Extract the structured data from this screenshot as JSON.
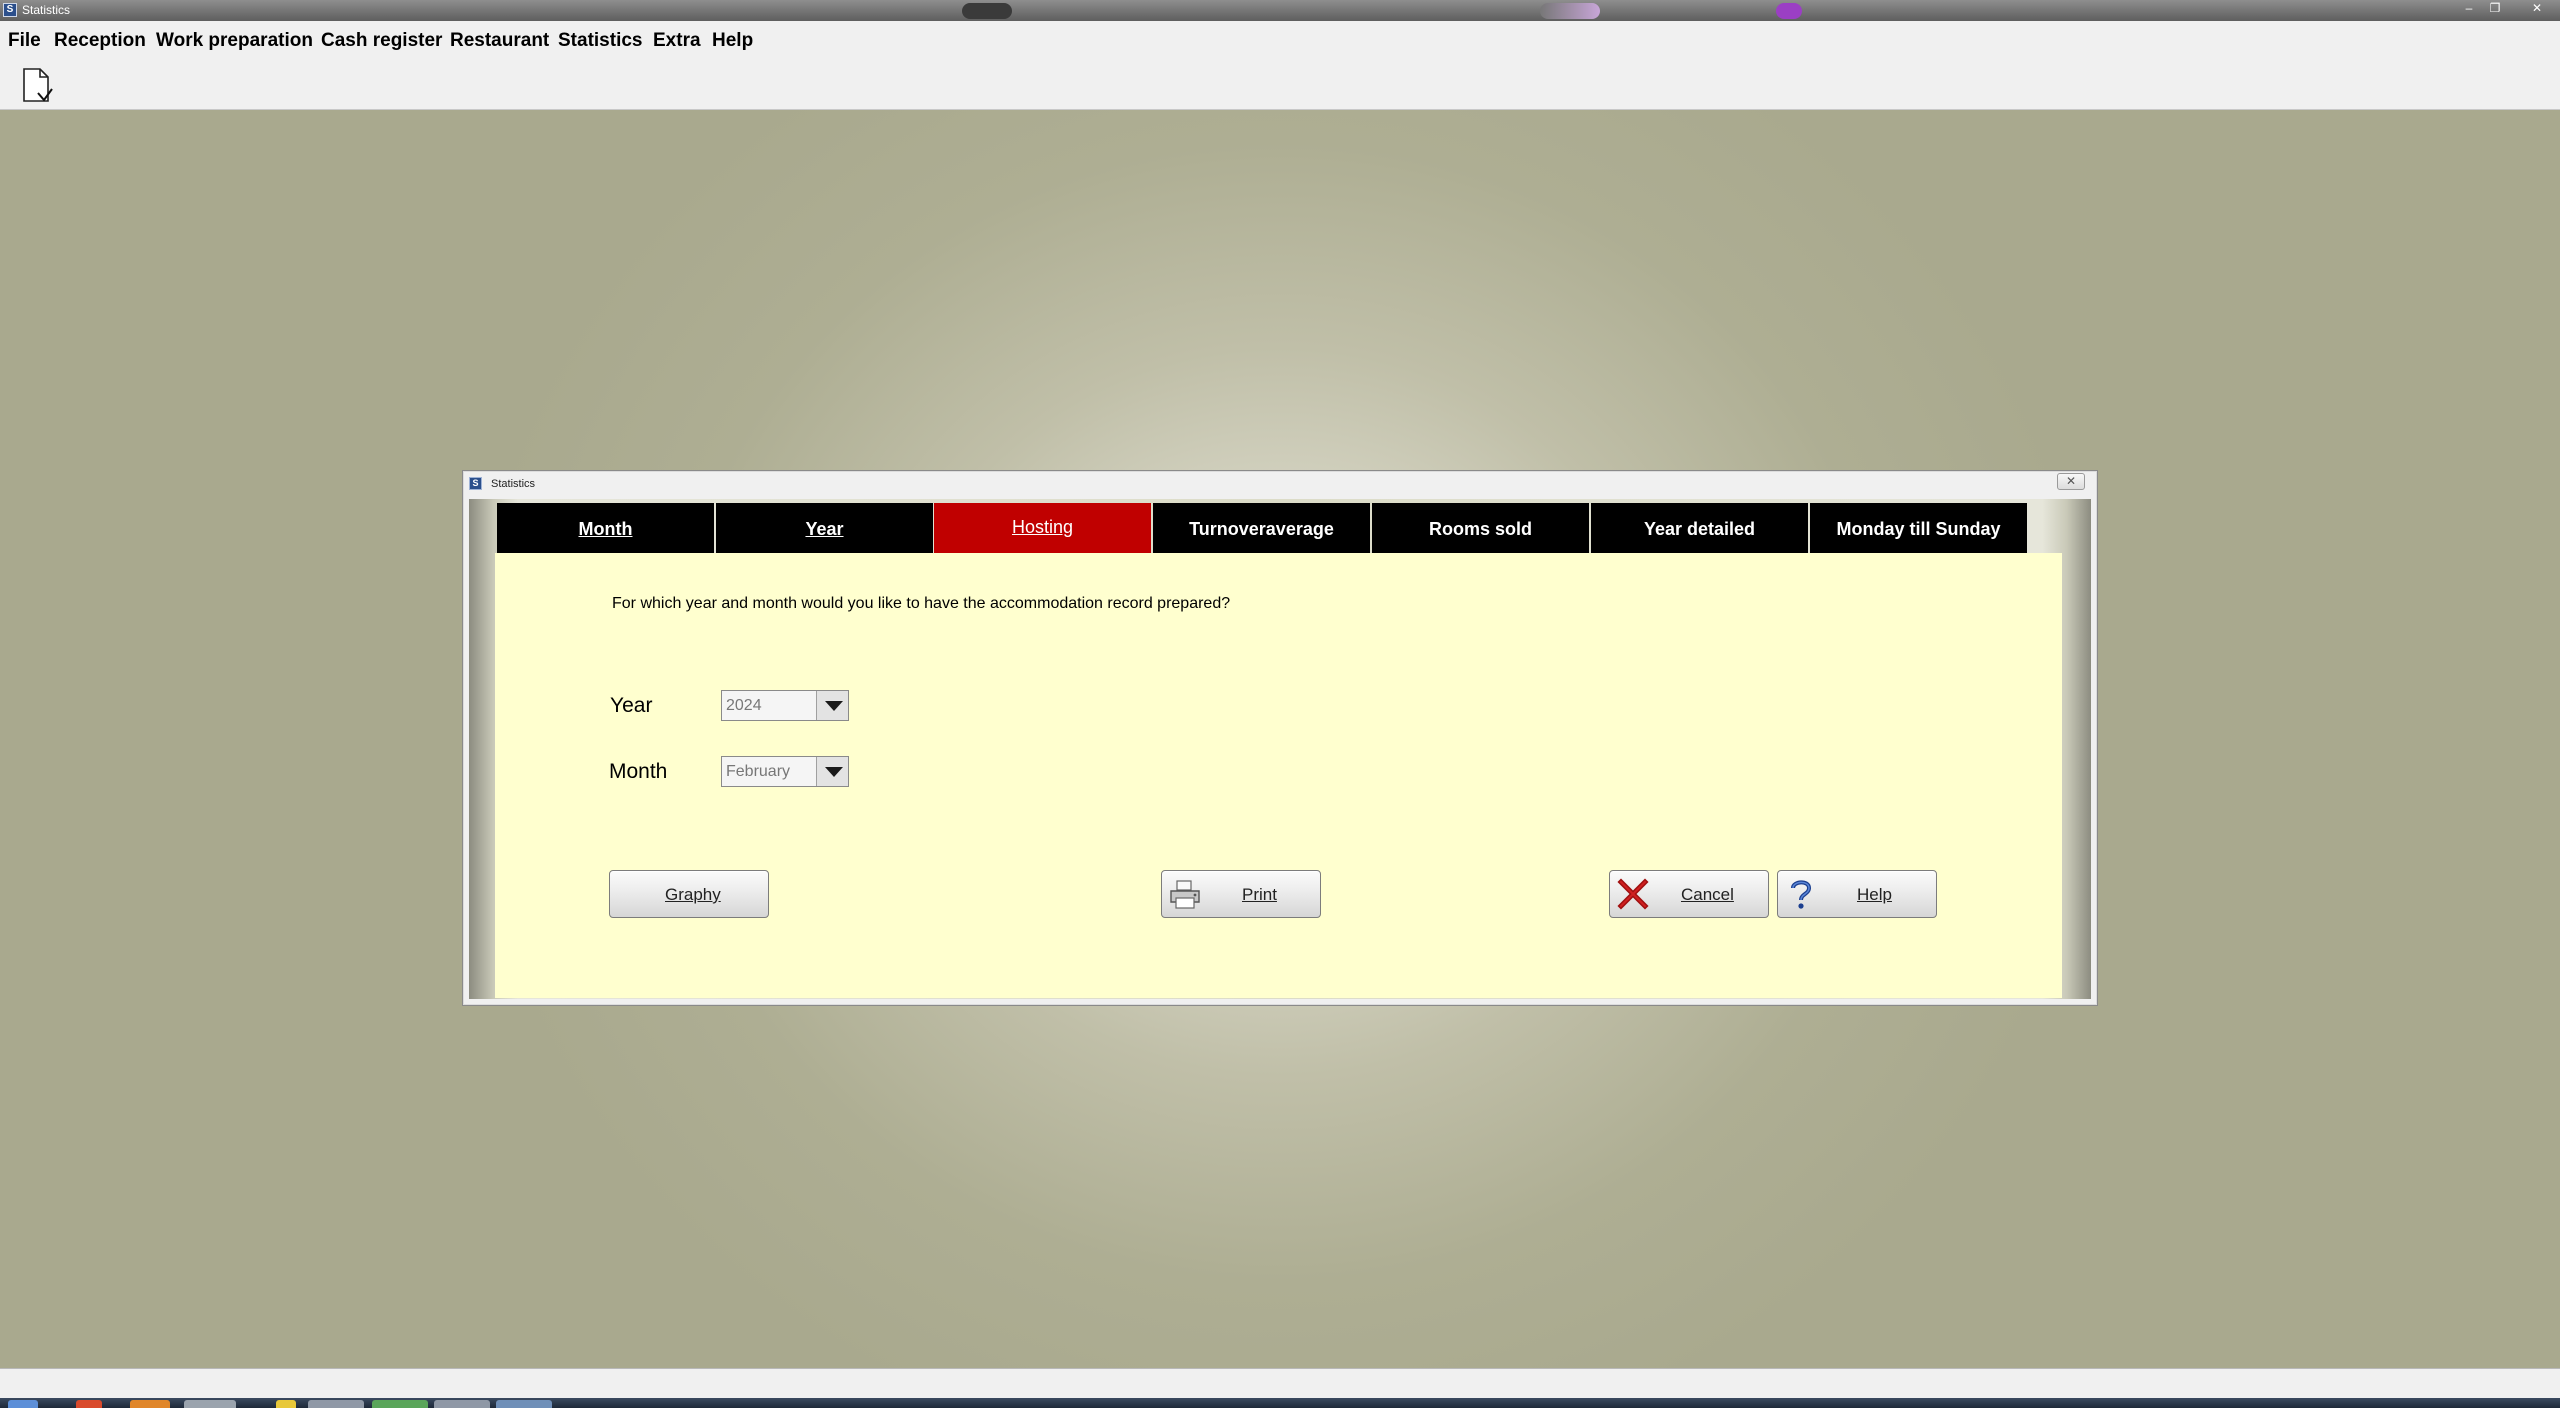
{
  "os_window": {
    "title": "Statistics",
    "app_icon_letter": "S"
  },
  "menubar": {
    "items": [
      {
        "label": "File"
      },
      {
        "label": "Reception"
      },
      {
        "label": "Work preparation"
      },
      {
        "label": "Cash register"
      },
      {
        "label": "Restaurant"
      },
      {
        "label": "Statistics"
      },
      {
        "label": "Extra"
      },
      {
        "label": "Help"
      }
    ]
  },
  "toolbar": {
    "icons": [
      "new-document-icon"
    ]
  },
  "dialog": {
    "title": "Statistics",
    "icon_letter": "S",
    "close_glyph": "✕",
    "tabs": [
      {
        "label": "Month",
        "active": false
      },
      {
        "label": "Year",
        "active": false
      },
      {
        "label": "Hosting",
        "active": true
      },
      {
        "label": "Turnoveraverage",
        "active": false
      },
      {
        "label": "Rooms sold",
        "active": false
      },
      {
        "label": "Year detailed",
        "active": false
      },
      {
        "label": "Monday till Sunday",
        "active": false
      }
    ],
    "prompt": "For which year and month would you like to have the accommodation record prepared?",
    "year": {
      "label": "Year",
      "value": "2024"
    },
    "month": {
      "label": "Month",
      "value": "February"
    },
    "buttons": {
      "graphy": "Graphy",
      "print": "Print",
      "cancel": "Cancel",
      "help": "Help"
    }
  },
  "colors": {
    "tab_background": "#000000",
    "tab_active_background": "#c00000",
    "panel_background": "#ffffcf",
    "desktop_background": "#a9a98e"
  }
}
